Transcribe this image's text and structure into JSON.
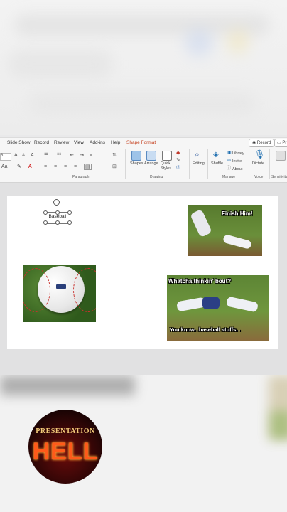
{
  "ribbon": {
    "tabs": [
      "Slide Show",
      "Record",
      "Review",
      "View",
      "Add-ins",
      "Help",
      "Shape Format"
    ],
    "record_button": "Record",
    "present_button": "Pr",
    "font_size": "8",
    "groups": {
      "paragraph": "Paragraph",
      "drawing": "Drawing",
      "voice": "Voice",
      "sensitivity": "Sensitivity"
    },
    "drawing_buttons": [
      "Shapes",
      "Arrange",
      "Quick Styles"
    ],
    "editing": "Editing",
    "shuffle": "Shuffle",
    "library": "Library",
    "invite": "Invite",
    "about": "About",
    "manage": "Manage",
    "dictate": "Dictate"
  },
  "slide": {
    "textbox_text": "Baseball",
    "meme1_text": "Finish Him!",
    "meme2_top": "Whatcha thinkin' bout?",
    "meme2_bottom": "You know...baseball stuffs..."
  },
  "logo": {
    "top": "PRESENTATION",
    "big": "HELL"
  },
  "colors": {
    "accent": "#c43e1c",
    "ribbon_bg": "#f6f6f6",
    "slide_bg": "#ffffff"
  }
}
